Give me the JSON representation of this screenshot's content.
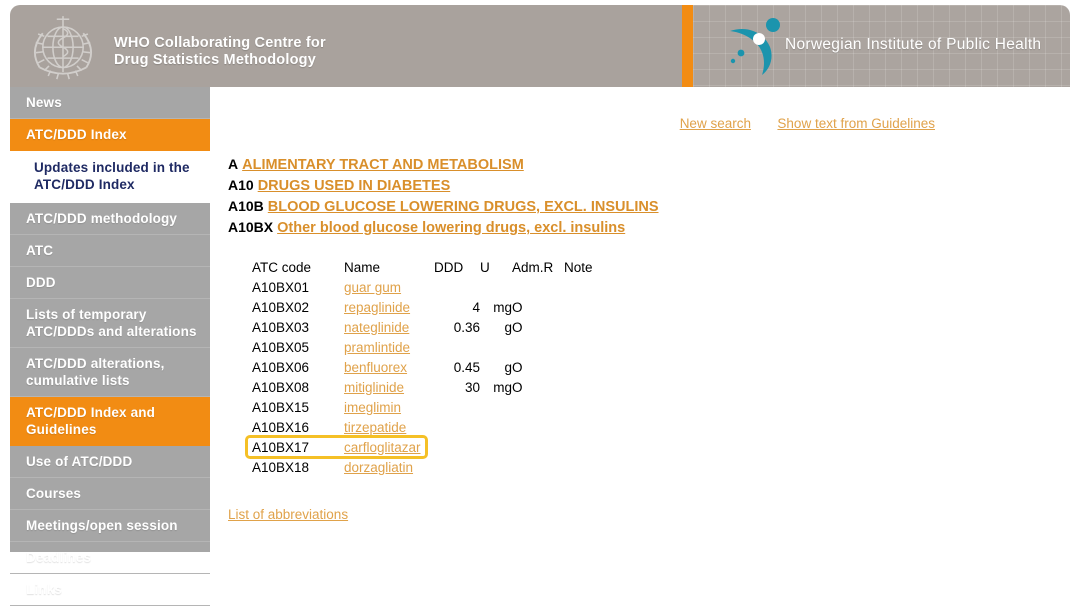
{
  "header": {
    "who": {
      "logo_name": "who-emblem-icon",
      "line1": "WHO Collaborating Centre for",
      "line2": "Drug Statistics Methodology"
    },
    "niph": {
      "logo_name": "niph-figure-icon",
      "title": "Norwegian Institute of Public Health"
    },
    "divider_color": "#f28c13"
  },
  "sidebar": {
    "items": [
      {
        "label": "News",
        "state": "normal"
      },
      {
        "label": "ATC/DDD Index",
        "state": "active"
      },
      {
        "label": "Updates included in the ATC/DDD Index",
        "state": "sub"
      },
      {
        "label": "ATC/DDD methodology",
        "state": "normal"
      },
      {
        "label": "ATC",
        "state": "normal"
      },
      {
        "label": "DDD",
        "state": "normal"
      },
      {
        "label": "Lists of temporary ATC/DDDs and alterations",
        "state": "normal"
      },
      {
        "label": "ATC/DDD alterations, cumulative lists",
        "state": "normal"
      },
      {
        "label": "ATC/DDD Index and Guidelines",
        "state": "active"
      },
      {
        "label": "Use of ATC/DDD",
        "state": "normal"
      },
      {
        "label": "Courses",
        "state": "normal"
      },
      {
        "label": "Meetings/open session",
        "state": "normal"
      },
      {
        "label": "Deadlines",
        "state": "normal"
      },
      {
        "label": "Links",
        "state": "normal"
      }
    ],
    "bg_color": "#a6a6a6",
    "active_color": "#f28c13"
  },
  "main": {
    "toplinks": [
      {
        "label": "New search"
      },
      {
        "label": "Show text from Guidelines"
      }
    ],
    "hierarchy": [
      {
        "code": "A",
        "label": "ALIMENTARY TRACT AND METABOLISM"
      },
      {
        "code": "A10",
        "label": "DRUGS USED IN DIABETES"
      },
      {
        "code": "A10B",
        "label": "BLOOD GLUCOSE LOWERING DRUGS, EXCL. INSULINS"
      },
      {
        "code": "A10BX",
        "label": "Other blood glucose lowering drugs, excl. insulins"
      }
    ],
    "table": {
      "columns": [
        "ATC code",
        "Name",
        "DDD",
        "U",
        "Adm.R",
        "Note"
      ],
      "rows": [
        {
          "code": "A10BX01",
          "name": "guar gum",
          "ddd": "",
          "u": "",
          "adm": "",
          "note": "",
          "highlighted": false
        },
        {
          "code": "A10BX02",
          "name": "repaglinide",
          "ddd": "4",
          "u": "mg",
          "adm": "O",
          "note": "",
          "highlighted": false
        },
        {
          "code": "A10BX03",
          "name": "nateglinide",
          "ddd": "0.36",
          "u": "g",
          "adm": "O",
          "note": "",
          "highlighted": false
        },
        {
          "code": "A10BX05",
          "name": "pramlintide",
          "ddd": "",
          "u": "",
          "adm": "",
          "note": "",
          "highlighted": false
        },
        {
          "code": "A10BX06",
          "name": "benfluorex",
          "ddd": "0.45",
          "u": "g",
          "adm": "O",
          "note": "",
          "highlighted": false
        },
        {
          "code": "A10BX08",
          "name": "mitiglinide",
          "ddd": "30",
          "u": "mg",
          "adm": "O",
          "note": "",
          "highlighted": false
        },
        {
          "code": "A10BX15",
          "name": "imeglimin",
          "ddd": "",
          "u": "",
          "adm": "",
          "note": "",
          "highlighted": false
        },
        {
          "code": "A10BX16",
          "name": "tirzepatide",
          "ddd": "",
          "u": "",
          "adm": "",
          "note": "",
          "highlighted": false
        },
        {
          "code": "A10BX17",
          "name": "carfloglitazar",
          "ddd": "",
          "u": "",
          "adm": "",
          "note": "",
          "highlighted": true
        },
        {
          "code": "A10BX18",
          "name": "dorzagliatin",
          "ddd": "",
          "u": "",
          "adm": "",
          "note": "",
          "highlighted": false
        }
      ],
      "highlight_color": "#f5c026"
    },
    "abbreviations_link": "List of abbreviations",
    "link_color": "#e0a24a"
  }
}
